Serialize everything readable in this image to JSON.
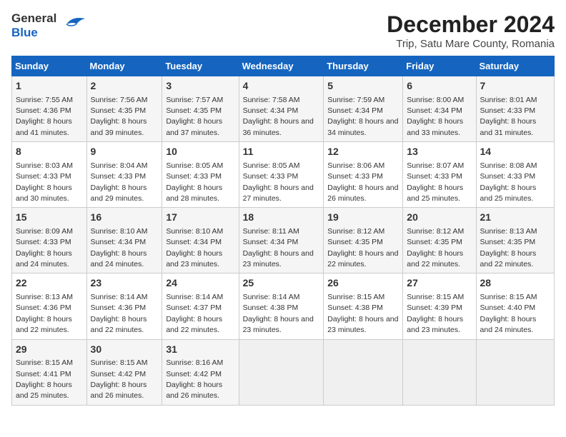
{
  "logo": {
    "line1": "General",
    "line2": "Blue"
  },
  "title": "December 2024",
  "subtitle": "Trip, Satu Mare County, Romania",
  "days_of_week": [
    "Sunday",
    "Monday",
    "Tuesday",
    "Wednesday",
    "Thursday",
    "Friday",
    "Saturday"
  ],
  "weeks": [
    [
      {
        "day": "1",
        "sunrise": "7:55 AM",
        "sunset": "4:36 PM",
        "daylight": "8 hours and 41 minutes."
      },
      {
        "day": "2",
        "sunrise": "7:56 AM",
        "sunset": "4:35 PM",
        "daylight": "8 hours and 39 minutes."
      },
      {
        "day": "3",
        "sunrise": "7:57 AM",
        "sunset": "4:35 PM",
        "daylight": "8 hours and 37 minutes."
      },
      {
        "day": "4",
        "sunrise": "7:58 AM",
        "sunset": "4:34 PM",
        "daylight": "8 hours and 36 minutes."
      },
      {
        "day": "5",
        "sunrise": "7:59 AM",
        "sunset": "4:34 PM",
        "daylight": "8 hours and 34 minutes."
      },
      {
        "day": "6",
        "sunrise": "8:00 AM",
        "sunset": "4:34 PM",
        "daylight": "8 hours and 33 minutes."
      },
      {
        "day": "7",
        "sunrise": "8:01 AM",
        "sunset": "4:33 PM",
        "daylight": "8 hours and 31 minutes."
      }
    ],
    [
      {
        "day": "8",
        "sunrise": "8:03 AM",
        "sunset": "4:33 PM",
        "daylight": "8 hours and 30 minutes."
      },
      {
        "day": "9",
        "sunrise": "8:04 AM",
        "sunset": "4:33 PM",
        "daylight": "8 hours and 29 minutes."
      },
      {
        "day": "10",
        "sunrise": "8:05 AM",
        "sunset": "4:33 PM",
        "daylight": "8 hours and 28 minutes."
      },
      {
        "day": "11",
        "sunrise": "8:05 AM",
        "sunset": "4:33 PM",
        "daylight": "8 hours and 27 minutes."
      },
      {
        "day": "12",
        "sunrise": "8:06 AM",
        "sunset": "4:33 PM",
        "daylight": "8 hours and 26 minutes."
      },
      {
        "day": "13",
        "sunrise": "8:07 AM",
        "sunset": "4:33 PM",
        "daylight": "8 hours and 25 minutes."
      },
      {
        "day": "14",
        "sunrise": "8:08 AM",
        "sunset": "4:33 PM",
        "daylight": "8 hours and 25 minutes."
      }
    ],
    [
      {
        "day": "15",
        "sunrise": "8:09 AM",
        "sunset": "4:33 PM",
        "daylight": "8 hours and 24 minutes."
      },
      {
        "day": "16",
        "sunrise": "8:10 AM",
        "sunset": "4:34 PM",
        "daylight": "8 hours and 24 minutes."
      },
      {
        "day": "17",
        "sunrise": "8:10 AM",
        "sunset": "4:34 PM",
        "daylight": "8 hours and 23 minutes."
      },
      {
        "day": "18",
        "sunrise": "8:11 AM",
        "sunset": "4:34 PM",
        "daylight": "8 hours and 23 minutes."
      },
      {
        "day": "19",
        "sunrise": "8:12 AM",
        "sunset": "4:35 PM",
        "daylight": "8 hours and 22 minutes."
      },
      {
        "day": "20",
        "sunrise": "8:12 AM",
        "sunset": "4:35 PM",
        "daylight": "8 hours and 22 minutes."
      },
      {
        "day": "21",
        "sunrise": "8:13 AM",
        "sunset": "4:35 PM",
        "daylight": "8 hours and 22 minutes."
      }
    ],
    [
      {
        "day": "22",
        "sunrise": "8:13 AM",
        "sunset": "4:36 PM",
        "daylight": "8 hours and 22 minutes."
      },
      {
        "day": "23",
        "sunrise": "8:14 AM",
        "sunset": "4:36 PM",
        "daylight": "8 hours and 22 minutes."
      },
      {
        "day": "24",
        "sunrise": "8:14 AM",
        "sunset": "4:37 PM",
        "daylight": "8 hours and 22 minutes."
      },
      {
        "day": "25",
        "sunrise": "8:14 AM",
        "sunset": "4:38 PM",
        "daylight": "8 hours and 23 minutes."
      },
      {
        "day": "26",
        "sunrise": "8:15 AM",
        "sunset": "4:38 PM",
        "daylight": "8 hours and 23 minutes."
      },
      {
        "day": "27",
        "sunrise": "8:15 AM",
        "sunset": "4:39 PM",
        "daylight": "8 hours and 23 minutes."
      },
      {
        "day": "28",
        "sunrise": "8:15 AM",
        "sunset": "4:40 PM",
        "daylight": "8 hours and 24 minutes."
      }
    ],
    [
      {
        "day": "29",
        "sunrise": "8:15 AM",
        "sunset": "4:41 PM",
        "daylight": "8 hours and 25 minutes."
      },
      {
        "day": "30",
        "sunrise": "8:15 AM",
        "sunset": "4:42 PM",
        "daylight": "8 hours and 26 minutes."
      },
      {
        "day": "31",
        "sunrise": "8:16 AM",
        "sunset": "4:42 PM",
        "daylight": "8 hours and 26 minutes."
      },
      null,
      null,
      null,
      null
    ]
  ]
}
